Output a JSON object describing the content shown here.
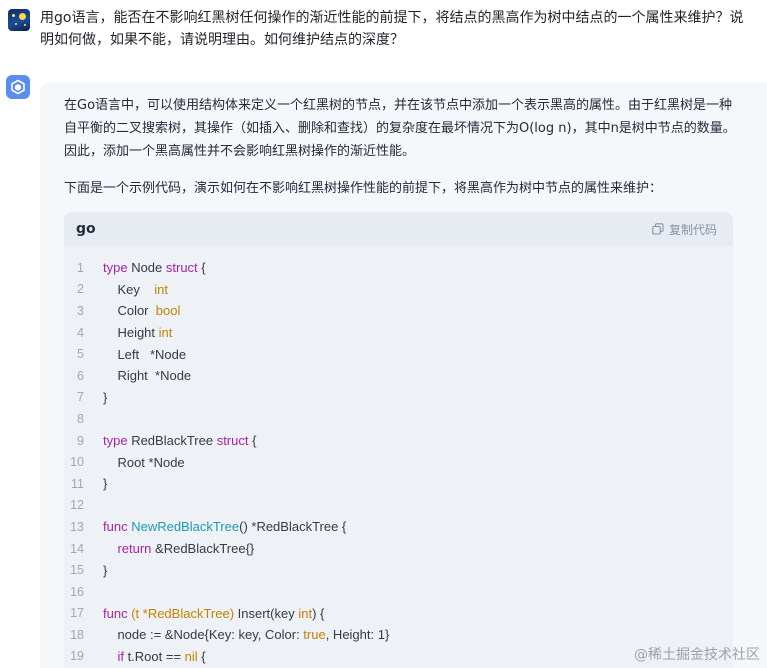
{
  "user_message": {
    "text": "用go语言，能否在不影响红黑树任何操作的渐近性能的前提下，将结点的黑高作为树中结点的一个属性来维护？说明如何做，如果不能，请说明理由。如何维护结点的深度？"
  },
  "assistant": {
    "para1": "在Go语言中，可以使用结构体来定义一个红黑树的节点，并在该节点中添加一个表示黑高的属性。由于红黑树是一种自平衡的二叉搜索树，其操作（如插入、删除和查找）的复杂度在最坏情况下为O(log n)，其中n是树中节点的数量。因此，添加一个黑高属性并不会影响红黑树操作的渐近性能。",
    "para2": "下面是一个示例代码，演示如何在不影响红黑树操作性能的前提下，将黑高作为树中节点的属性来维护：",
    "code": {
      "language": "go",
      "copy_label": "复制代码",
      "copy_icon": "copy-icon",
      "lines": [
        {
          "n": "1",
          "parts": [
            [
              "kw",
              "type"
            ],
            [
              "t",
              " Node "
            ],
            [
              "kw",
              "struct"
            ],
            [
              "t",
              " {"
            ]
          ]
        },
        {
          "n": "2",
          "parts": [
            [
              "t",
              "    Key    "
            ],
            [
              "ty",
              "int"
            ]
          ]
        },
        {
          "n": "3",
          "parts": [
            [
              "t",
              "    Color  "
            ],
            [
              "ty",
              "bool"
            ]
          ]
        },
        {
          "n": "4",
          "parts": [
            [
              "t",
              "    Height "
            ],
            [
              "ty",
              "int"
            ]
          ]
        },
        {
          "n": "5",
          "parts": [
            [
              "t",
              "    Left   *Node"
            ]
          ]
        },
        {
          "n": "6",
          "parts": [
            [
              "t",
              "    Right  *Node"
            ]
          ]
        },
        {
          "n": "7",
          "parts": [
            [
              "t",
              "}"
            ]
          ]
        },
        {
          "n": "8",
          "parts": []
        },
        {
          "n": "9",
          "parts": [
            [
              "kw",
              "type"
            ],
            [
              "t",
              " RedBlackTree "
            ],
            [
              "kw",
              "struct"
            ],
            [
              "t",
              " {"
            ]
          ]
        },
        {
          "n": "10",
          "parts": [
            [
              "t",
              "    Root *Node"
            ]
          ]
        },
        {
          "n": "11",
          "parts": [
            [
              "t",
              "}"
            ]
          ]
        },
        {
          "n": "12",
          "parts": []
        },
        {
          "n": "13",
          "parts": [
            [
              "kw",
              "func"
            ],
            [
              "t",
              " "
            ],
            [
              "fn",
              "NewRedBlackTree"
            ],
            [
              "t",
              "() *RedBlackTree {"
            ]
          ]
        },
        {
          "n": "14",
          "parts": [
            [
              "t",
              "    "
            ],
            [
              "kw",
              "return"
            ],
            [
              "t",
              " &RedBlackTree{}"
            ]
          ]
        },
        {
          "n": "15",
          "parts": [
            [
              "t",
              "}"
            ]
          ]
        },
        {
          "n": "16",
          "parts": []
        },
        {
          "n": "17",
          "parts": [
            [
              "kw",
              "func"
            ],
            [
              "t",
              " "
            ],
            [
              "ty",
              "(t *RedBlackTree)"
            ],
            [
              "t",
              " Insert(key "
            ],
            [
              "ty",
              "int"
            ],
            [
              "t",
              ") {"
            ]
          ]
        },
        {
          "n": "18",
          "parts": [
            [
              "t",
              "    node := &Node{Key: key, Color: "
            ],
            [
              "bl",
              "true"
            ],
            [
              "t",
              ", Height: 1}"
            ]
          ]
        },
        {
          "n": "19",
          "parts": [
            [
              "t",
              "    "
            ],
            [
              "kw",
              "if"
            ],
            [
              "t",
              " t.Root == "
            ],
            [
              "nl",
              "nil"
            ],
            [
              "t",
              " {"
            ]
          ]
        }
      ]
    }
  },
  "watermark": {
    "text": "@稀土掘金技术社区"
  },
  "colors": {
    "card_bg": "#f5f7fa",
    "code_bg": "#eef1f6",
    "code_header_bg": "#e7ebf2",
    "ai_avatar": "#5b8def",
    "keyword": "#a626a4",
    "type": "#c18401",
    "function": "#1c9bb0"
  }
}
